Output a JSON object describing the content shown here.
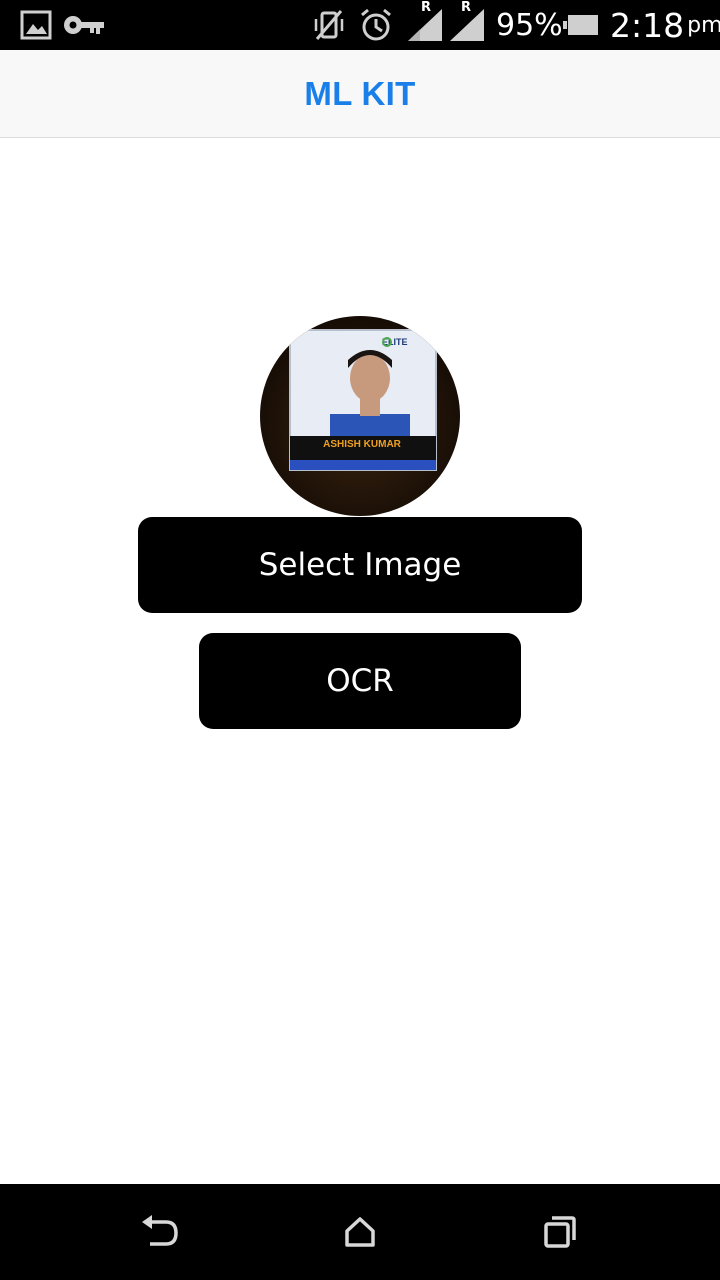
{
  "status_bar": {
    "icons": [
      "image-notification-icon",
      "vpn-key-icon",
      "vibrate-off-icon",
      "alarm-icon",
      "signal-sim1-icon",
      "signal-sim2-icon",
      "battery-icon"
    ],
    "roaming_indicator_1": "R",
    "roaming_indicator_2": "R",
    "battery_percent": "95%",
    "time": "2:18",
    "time_suffix": "pm"
  },
  "app_bar": {
    "title": "ML KIT"
  },
  "main": {
    "photo": {
      "badge_brand": "ELITE",
      "badge_name": "ASHISH KUMAR",
      "icon": "profile-photo"
    },
    "select_image_label": "Select Image",
    "ocr_label": "OCR"
  },
  "nav_bar": {
    "icons": [
      "back-icon",
      "home-icon",
      "recents-icon"
    ]
  },
  "colors": {
    "title": "#1a7fe8",
    "button_bg": "#000000",
    "button_text": "#ffffff",
    "app_bar_bg": "#f8f8f8"
  }
}
